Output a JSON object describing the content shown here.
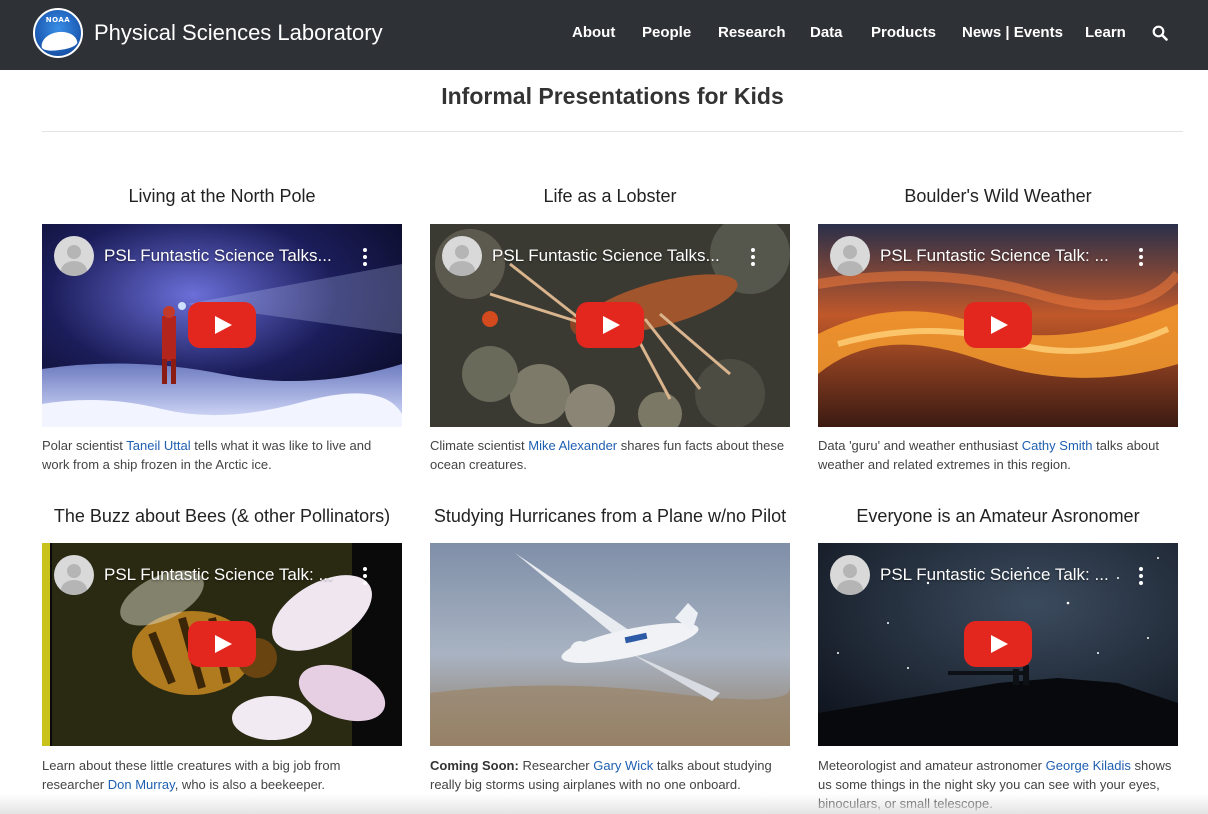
{
  "header": {
    "site_title": "Physical Sciences Laboratory",
    "logo_text": "NOAA",
    "nav": [
      "About",
      "People",
      "Research",
      "Data",
      "Products",
      "News | Events",
      "Learn"
    ],
    "search_icon": "search-icon"
  },
  "page": {
    "title": "Informal Presentations for Kids"
  },
  "cards": [
    {
      "title": "Living at the North Pole",
      "video_title": "PSL Funtastic Science Talks...",
      "desc_pre": "Polar scientist ",
      "link": "Taneil Uttal",
      "desc_post": " tells what it was like to live and work from a ship frozen in the Arctic ice."
    },
    {
      "title": "Life as a Lobster",
      "video_title": "PSL Funtastic Science Talks...",
      "desc_pre": "Climate scientist ",
      "link": "Mike Alexander",
      "desc_post": " shares fun facts about these ocean creatures."
    },
    {
      "title": "Boulder's Wild Weather",
      "video_title": "PSL Funtastic Science Talk: ...",
      "desc_pre": "Data 'guru' and weather enthusiast ",
      "link": "Cathy Smith",
      "desc_post": " talks about weather and related extremes in this region."
    },
    {
      "title": "The Buzz about Bees (& other Pollinators)",
      "video_title": "PSL Funtastic Science Talk: ...",
      "desc_pre": "Learn about these little creatures with a big job from researcher ",
      "link": "Don Murray",
      "desc_post": ", who is also a beekeeper."
    },
    {
      "title": "Studying Hurricanes from a Plane w/no Pilot",
      "desc_bold": "Coming Soon:",
      "desc_pre": " Researcher ",
      "link": "Gary Wick",
      "desc_post": " talks about studying really big storms using airplanes with no one onboard."
    },
    {
      "title": "Everyone is an Amateur Asronomer",
      "video_title": "PSL Funtastic Science Talk: ...",
      "desc_pre": "Meteorologist and amateur astronomer ",
      "link": "George Kiladis",
      "desc_post": " shows us some things in the night sky you can see with your eyes, binoculars, or small telescope."
    }
  ]
}
